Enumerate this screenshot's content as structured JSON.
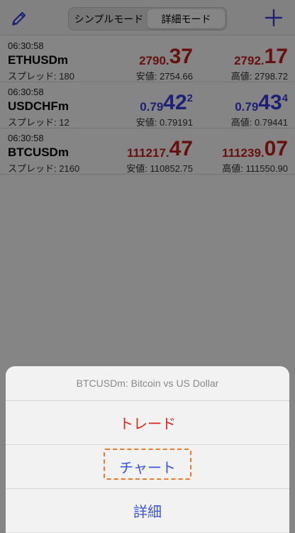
{
  "navbar": {
    "mode_simple": "シンプルモード",
    "mode_detail": "詳細モード",
    "active_mode": "詳細モード",
    "edit_icon": "pencil-icon",
    "add_icon": "plus-icon",
    "accent_color": "#3a3fe0"
  },
  "quotes": [
    {
      "time": "06:30:58",
      "symbol": "ETHUSDm",
      "spread_label": "スプレッド:",
      "spread": "180",
      "bid_main": "2790.",
      "bid_big": "37",
      "bid_sup": "",
      "ask_main": "2792.",
      "ask_big": "17",
      "ask_sup": "",
      "low_label": "安値:",
      "low": "2754.66",
      "high_label": "高値:",
      "high": "2798.72",
      "color": "#c7201a"
    },
    {
      "time": "06:30:58",
      "symbol": "USDCHFm",
      "spread_label": "スプレッド:",
      "spread": "12",
      "bid_main": "0.79",
      "bid_big": "42",
      "bid_sup": "2",
      "ask_main": "0.79",
      "ask_big": "43",
      "ask_sup": "4",
      "low_label": "安値:",
      "low": "0.79191",
      "high_label": "高値:",
      "high": "0.79441",
      "color": "#3a3fe0"
    },
    {
      "time": "06:30:58",
      "symbol": "BTCUSDm",
      "spread_label": "スプレッド:",
      "spread": "2160",
      "bid_main": "111217.",
      "bid_big": "47",
      "bid_sup": "",
      "ask_main": "111239.",
      "ask_big": "07",
      "ask_sup": "",
      "low_label": "安値:",
      "low": "110852.75",
      "high_label": "高値:",
      "high": "111550.90",
      "color": "#c7201a"
    }
  ],
  "action_sheet": {
    "title": "BTCUSDm: Bitcoin vs US Dollar",
    "trade_label": "トレード",
    "chart_label": "チャート",
    "details_label": "詳細",
    "trade_color": "#e0261c",
    "action_color": "#3a54e4",
    "highlight_color": "#e87a2a"
  }
}
